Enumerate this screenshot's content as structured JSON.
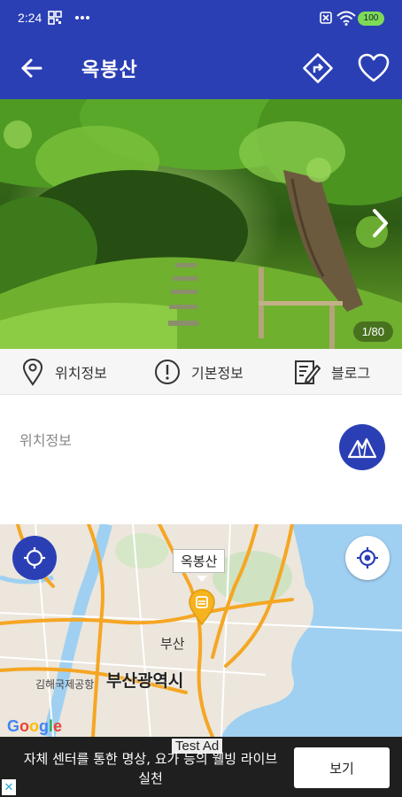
{
  "status_bar": {
    "time": "2:24",
    "battery": "100",
    "icons": [
      "grid-icon",
      "more-icon",
      "sim-off-icon",
      "wifi-icon",
      "battery-icon"
    ]
  },
  "app_bar": {
    "title": "옥봉산",
    "back_icon": "arrow-left-icon",
    "route_icon": "directions-icon",
    "favorite_icon": "heart-outline-icon",
    "color": "#2B3FB5"
  },
  "gallery": {
    "counter": "1/80",
    "next_icon": "chevron-right-icon"
  },
  "tabs": [
    {
      "label": "위치정보",
      "icon": "location-pin-icon"
    },
    {
      "label": "기본정보",
      "icon": "info-circle-icon"
    },
    {
      "label": "블로그",
      "icon": "edit-note-icon"
    }
  ],
  "location_section": {
    "title": "위치정보",
    "button_icon": "mountain-icon"
  },
  "map": {
    "marker_label": "옥봉산",
    "city_label": "부산",
    "city_big": "부산광역시",
    "airport": "김해국제공항",
    "attribution": "Google",
    "left_button_icon": "my-location-icon",
    "right_button_icon": "my-location-icon"
  },
  "ad": {
    "label": "Test Ad",
    "text": "자체 센터를 통한 명상, 요가 등의 웰빙 라이브 실천",
    "button": "보기",
    "close_icon": "adchoices-x-icon"
  }
}
